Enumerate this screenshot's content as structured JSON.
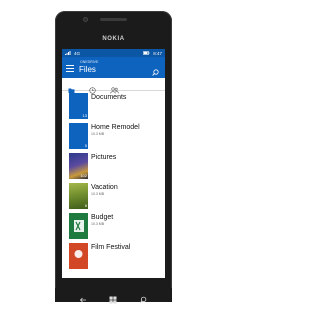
{
  "device": {
    "brand": "NOKIA"
  },
  "statusbar": {
    "time": "8:47",
    "network": "4G"
  },
  "appbar": {
    "subtitle": "ONEDRIVE",
    "title": "Files"
  },
  "tabs": [
    {
      "icon": "folder-icon",
      "active": true
    },
    {
      "icon": "clock-icon",
      "active": false
    },
    {
      "icon": "people-icon",
      "active": false
    }
  ],
  "items": [
    {
      "name": "Documents",
      "meta": "",
      "count": "13",
      "thumb": "blue-folder",
      "color": "#0e63bf"
    },
    {
      "name": "Home Remodel",
      "meta": "10.3 MB",
      "count": "5",
      "thumb": "blue-folder",
      "color": "#0e63bf"
    },
    {
      "name": "Pictures",
      "meta": "",
      "count": "102",
      "thumb": "photo",
      "color": "#4b3f8f"
    },
    {
      "name": "Vacation",
      "meta": "10.3 MB",
      "count": "8",
      "thumb": "photo",
      "color": "#6d8b2c"
    },
    {
      "name": "Budget",
      "meta": "10.3 MB",
      "count": "",
      "thumb": "excel",
      "color": "#1e7a3e"
    },
    {
      "name": "Film Festival",
      "meta": "",
      "count": "",
      "thumb": "powerpoint",
      "color": "#d24726"
    }
  ]
}
